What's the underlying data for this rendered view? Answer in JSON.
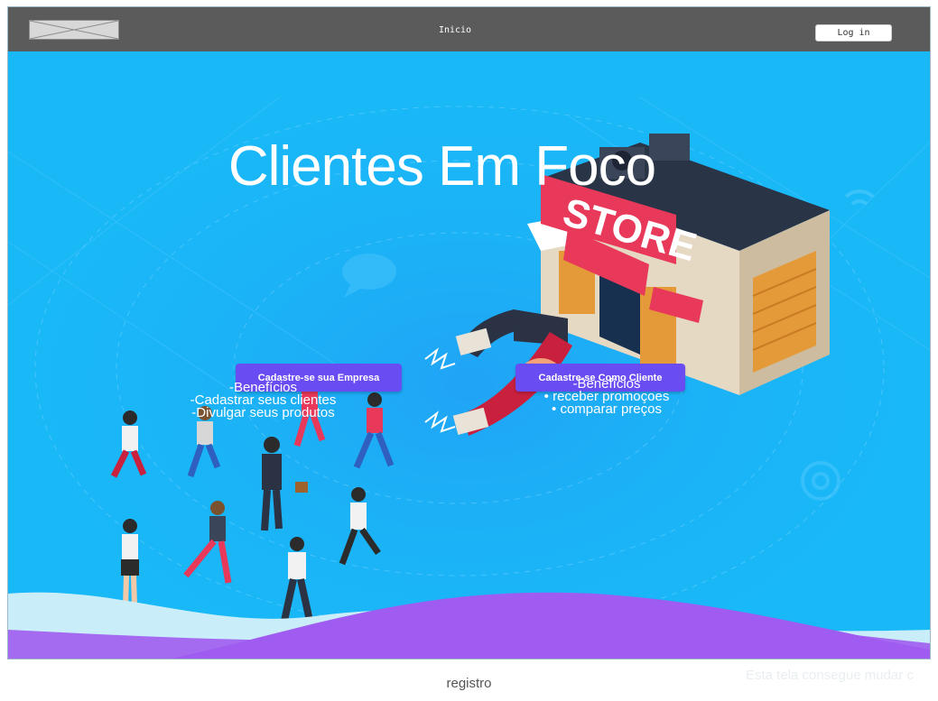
{
  "header": {
    "home_label": "Inicio",
    "login_label": "Log in"
  },
  "hero": {
    "title": "Clientes Em Foco",
    "store_sign": "STORE",
    "company_button": "Cadastre-se sua Empresa",
    "client_button": "Cadastre-se Como Cliente",
    "company_benefits": [
      "-Benefícios",
      "-Cadastrar seus clientes",
      "-Divulgar seus produtos"
    ],
    "client_benefits_title": "-Benefícios",
    "client_benefits": [
      "receber promoçoes",
      "comparar preços"
    ]
  },
  "caption": "registro",
  "side_note": "Esta tela consegue mudar c",
  "colors": {
    "topbar": "#5b5b5b",
    "hero_bg": "#19b8f7",
    "button": "#6a4df2",
    "wave_purple": "#a05cf0",
    "store_sign": "#e8395a"
  }
}
